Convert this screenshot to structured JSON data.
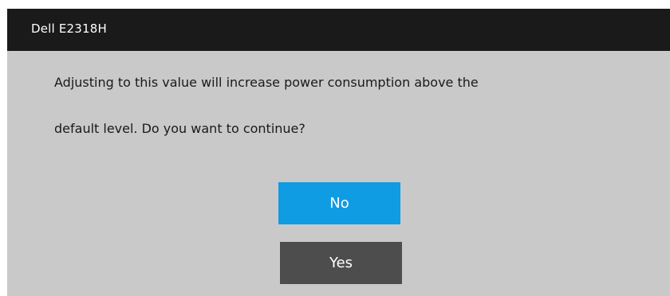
{
  "dialog": {
    "title": "Dell  E2318H",
    "message_lines": [
      "Adjusting to this value will increase power consumption above the",
      "default level. Do you want to continue?"
    ],
    "buttons": {
      "no_label": "No",
      "yes_label": "Yes"
    },
    "colors": {
      "title_bar": "#1a1a1a",
      "panel": "#c9c9c9",
      "selected_button": "#0f9ce3",
      "unselected_button": "#4d4d4d"
    }
  }
}
